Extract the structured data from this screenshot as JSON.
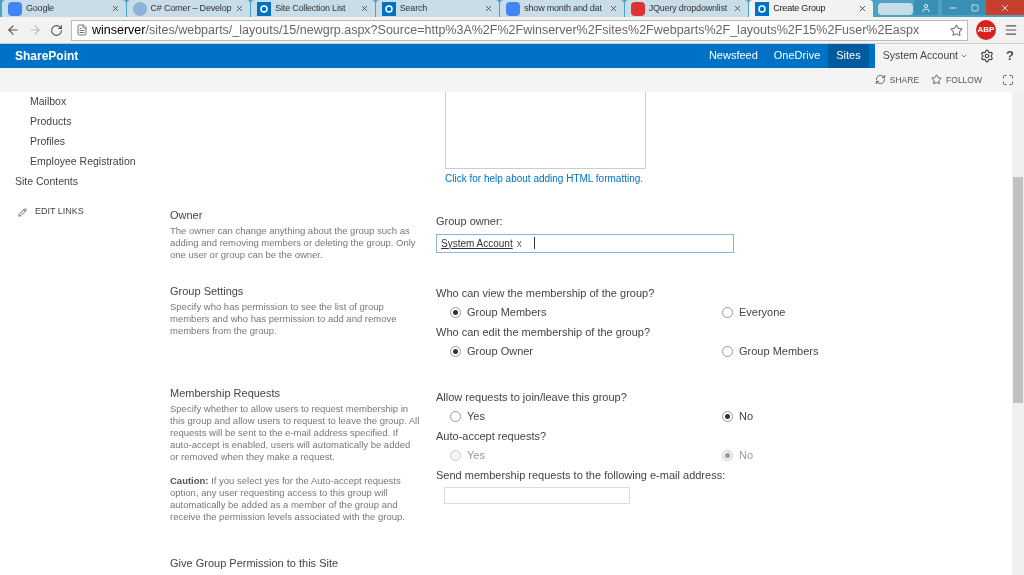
{
  "browser": {
    "tabs": [
      {
        "title": "Google",
        "selected": false
      },
      {
        "title": "C# Corner – Develop",
        "selected": false
      },
      {
        "title": "Site Collection List",
        "selected": false
      },
      {
        "title": "Search",
        "selected": false
      },
      {
        "title": "show month and dat",
        "selected": false
      },
      {
        "title": "JQuery dropdownlist",
        "selected": false
      },
      {
        "title": "Create Group",
        "selected": true
      }
    ],
    "address": {
      "host": "winserver",
      "path": "/sites/webparts/_layouts/15/newgrp.aspx?Source=http%3A%2F%2Fwinserver%2Fsites%2Fwebparts%2F_layouts%2F15%2Fuser%2Easpx"
    },
    "extension_badge": "ABP"
  },
  "suite_bar": {
    "brand": "SharePoint",
    "links": [
      {
        "label": "Newsfeed",
        "selected": false
      },
      {
        "label": "OneDrive",
        "selected": false
      },
      {
        "label": "Sites",
        "selected": true
      }
    ],
    "account": "System Account",
    "help": "?"
  },
  "ribbon": {
    "actions": [
      {
        "label": "SHARE"
      },
      {
        "label": "FOLLOW"
      }
    ]
  },
  "left_nav": {
    "items": [
      {
        "label": "Mailbox"
      },
      {
        "label": "Products"
      },
      {
        "label": "Profiles"
      },
      {
        "label": "Employee Registration"
      }
    ],
    "site_contents": "Site Contents",
    "edit_links": "EDIT LINKS"
  },
  "html_help_link": "Click for help about adding HTML formatting.",
  "sections": [
    {
      "kind": "owner",
      "title": "Owner",
      "description": "The owner can change anything about the group such as adding and removing members or deleting the group. Only one user or group can be the owner.",
      "field_label": "Group owner:",
      "people": [
        "System Account"
      ],
      "remove": "x"
    },
    {
      "kind": "radios",
      "title": "Group Settings",
      "description": "Specify who has permission to see the list of group members and who has permission to add and remove members from the group.",
      "questions": [
        {
          "label": "Who can view the membership of the group?",
          "options": [
            {
              "label": "Group Members",
              "selected": true,
              "disabled": false
            },
            {
              "label": "Everyone",
              "selected": false,
              "disabled": false
            }
          ]
        },
        {
          "label": "Who can edit the membership of the group?",
          "options": [
            {
              "label": "Group Owner",
              "selected": true,
              "disabled": false
            },
            {
              "label": "Group Members",
              "selected": false,
              "disabled": false
            }
          ]
        }
      ]
    },
    {
      "kind": "requests",
      "title": "Membership Requests",
      "description": "Specify whether to allow users to request membership in this group and allow users to request to leave the group. All requests will be sent to the e-mail address specified. If auto-accept is enabled, users will automatically be added or removed when they make a request.",
      "caution": "**Caution:** If you select yes for the Auto-accept requests option, any user requesting access to this group will automatically be added as a member of the group and receive the permission levels associated with the group.",
      "questions": [
        {
          "label": "Allow requests to join/leave this group?",
          "options": [
            {
              "label": "Yes",
              "selected": false,
              "disabled": false
            },
            {
              "label": "No",
              "selected": true,
              "disabled": false
            }
          ]
        },
        {
          "label": "Auto-accept requests?",
          "options": [
            {
              "label": "Yes",
              "selected": false,
              "disabled": true
            },
            {
              "label": "No",
              "selected": true,
              "disabled": true
            }
          ]
        }
      ],
      "email_label": "Send membership requests to the following e-mail address:"
    },
    {
      "kind": "title_only",
      "title": "Give Group Permission to this Site"
    }
  ]
}
